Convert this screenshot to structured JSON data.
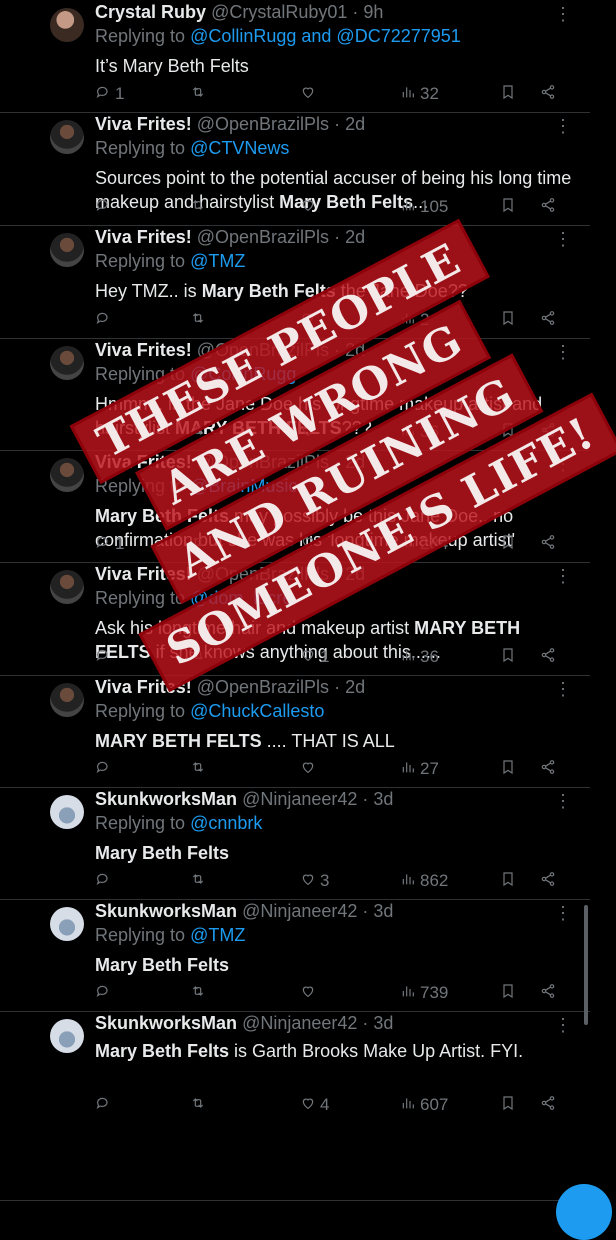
{
  "tweets": [
    {
      "name": "Crystal Ruby",
      "handle": "@CrystalRuby01",
      "time": "9h",
      "avatar": "avatar",
      "reply_prefix": "Replying to",
      "reply_to": "@CollinRugg and @DC72277951",
      "text": [
        {
          "t": "It’s Mary Beth Felts",
          "b": false
        }
      ],
      "replies": "1",
      "retweets": "",
      "likes": "",
      "views": "32"
    },
    {
      "name": "Viva Frites!",
      "handle": "@OpenBrazilPls",
      "time": "2d",
      "avatar": "viva",
      "reply_prefix": "Replying to",
      "reply_to": "@CTVNews",
      "text": [
        {
          "t": "Sources point to the potential accuser of being his long time makeup and hairstylist ",
          "b": false
        },
        {
          "t": "Mary Beth Felts",
          "b": true
        },
        {
          "t": "...",
          "b": false
        }
      ],
      "replies": "",
      "retweets": "",
      "likes": "",
      "views": "105"
    },
    {
      "name": "Viva Frites!",
      "handle": "@OpenBrazilPls",
      "time": "2d",
      "avatar": "viva",
      "reply_prefix": "Replying to",
      "reply_to": "@TMZ",
      "text": [
        {
          "t": "Hey TMZ.. is ",
          "b": false
        },
        {
          "t": "Mary Beth Felts",
          "b": true
        },
        {
          "t": " the Jane Doe??",
          "b": false
        }
      ],
      "replies": "",
      "retweets": "",
      "likes": "",
      "views": "2"
    },
    {
      "name": "Viva Frites!",
      "handle": "@OpenBrazilPls",
      "time": "2d",
      "avatar": "viva",
      "reply_prefix": "Replying to",
      "reply_to": "@CollinRugg",
      "text": [
        {
          "t": "Hmmm.. is the Jane Doe his longtime makeup artist and hairstylist ",
          "b": false
        },
        {
          "t": "MARY BETH FELTS",
          "b": true
        },
        {
          "t": "???",
          "b": false
        }
      ],
      "replies": "",
      "retweets": "",
      "likes": "",
      "views": "36"
    },
    {
      "name": "Viva Frites!",
      "handle": "@OpenBrazilPls",
      "time": "2d",
      "avatar": "viva",
      "reply_prefix": "Replying to",
      "reply_to": "@BrainMusic",
      "text": [
        {
          "t": "Mary Beth Felts",
          "b": true
        },
        {
          "t": " may possibly be this Jane Doe.. no confirmation but she was his 'longtime makeup artist'",
          "b": false
        }
      ],
      "replies": "1",
      "retweets": "",
      "likes": "",
      "views": "284"
    },
    {
      "name": "Viva Frites!",
      "handle": "@OpenBrazilPls",
      "time": "2d",
      "avatar": "viva",
      "reply_prefix": "Replying to",
      "reply_to": "@dom_lucre",
      "text": [
        {
          "t": "Ask his longtime hair and makeup artist ",
          "b": false
        },
        {
          "t": "MARY BETH FELTS",
          "b": true
        },
        {
          "t": " if she knows anything about this......",
          "b": false
        }
      ],
      "replies": "",
      "retweets": "",
      "likes": "1",
      "views": "36"
    },
    {
      "name": "Viva Frites!",
      "handle": "@OpenBrazilPls",
      "time": "2d",
      "avatar": "viva",
      "reply_prefix": "Replying to",
      "reply_to": "@ChuckCallesto",
      "text": [
        {
          "t": "MARY BETH FELTS",
          "b": true
        },
        {
          "t": " .... THAT IS ALL",
          "b": false
        }
      ],
      "replies": "",
      "retweets": "",
      "likes": "",
      "views": "27"
    },
    {
      "name": "SkunkworksMan",
      "handle": "@Ninjaneer42",
      "time": "3d",
      "avatar": "skunk",
      "reply_prefix": "Replying to",
      "reply_to": "@cnnbrk",
      "text": [
        {
          "t": "Mary Beth Felts",
          "b": true
        }
      ],
      "replies": "",
      "retweets": "",
      "likes": "3",
      "views": "862"
    },
    {
      "name": "SkunkworksMan",
      "handle": "@Ninjaneer42",
      "time": "3d",
      "avatar": "skunk",
      "reply_prefix": "Replying to",
      "reply_to": "@TMZ",
      "text": [
        {
          "t": "Mary Beth Felts",
          "b": true
        }
      ],
      "replies": "",
      "retweets": "",
      "likes": "",
      "views": "739"
    },
    {
      "name": "SkunkworksMan",
      "handle": "@Ninjaneer42",
      "time": "3d",
      "avatar": "skunk",
      "reply_prefix": "",
      "reply_to": "",
      "text": [
        {
          "t": "Mary Beth Felts",
          "b": true
        },
        {
          "t": " is Garth Brooks Make Up Artist. FYI.",
          "b": false
        }
      ],
      "replies": "",
      "retweets": "",
      "likes": "4",
      "views": "607"
    }
  ],
  "overlay": {
    "lines": [
      "THESE PEOPLE",
      "ARE WRONG",
      "AND RUINING",
      "SOMEONE'S LIFE!"
    ],
    "color": "#be141c"
  },
  "colors": {
    "background": "#000000",
    "link": "#1d9bf0",
    "muted": "#71767b",
    "text": "#e7e9ea"
  },
  "icons": {
    "reply": "reply-icon",
    "retweet": "retweet-icon",
    "like": "heart-icon",
    "views": "views-icon",
    "bookmark": "bookmark-icon",
    "share": "share-icon",
    "more": "more-icon"
  }
}
